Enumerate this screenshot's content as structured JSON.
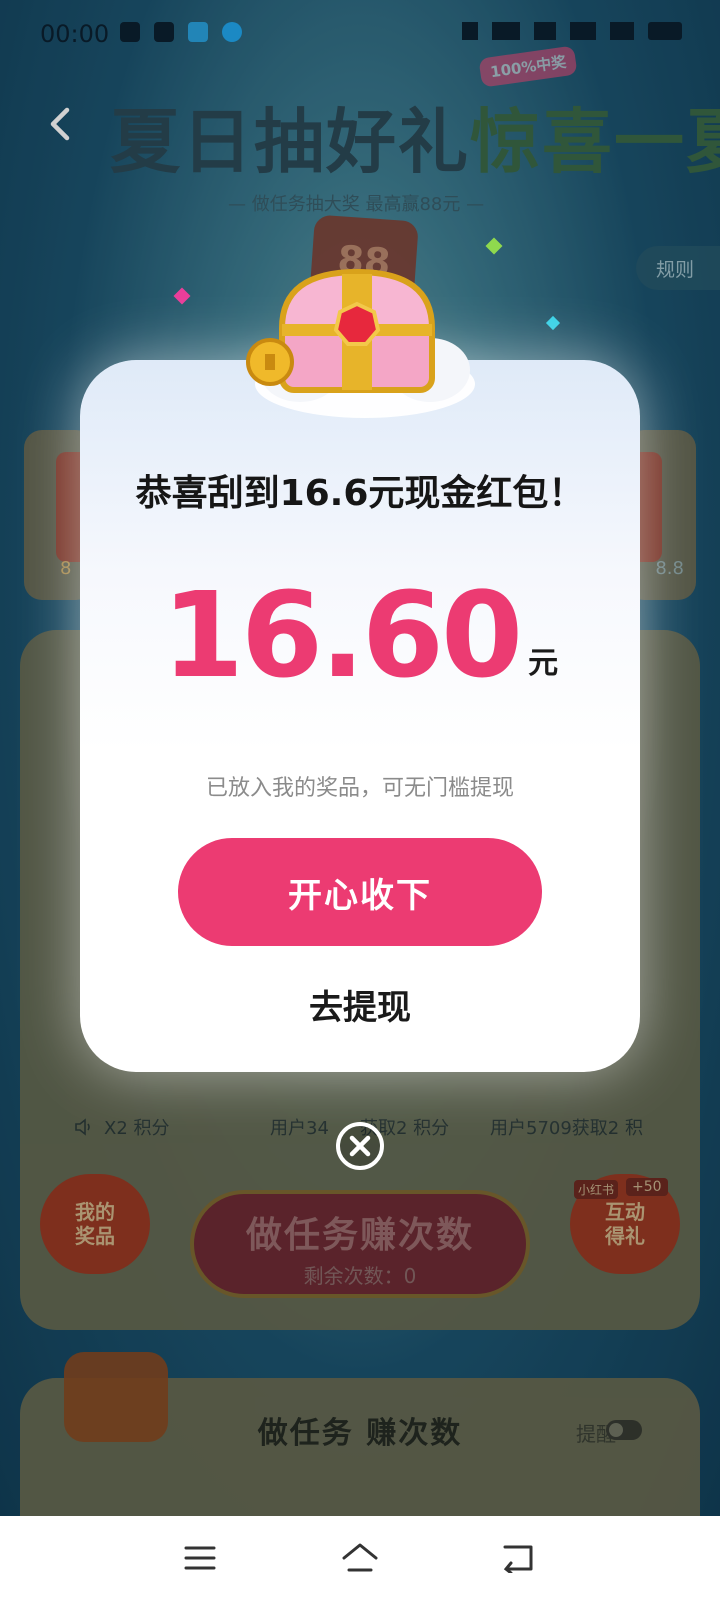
{
  "status_bar": {
    "time": "00:00"
  },
  "background": {
    "hero_title_part1": "夏日抽好礼",
    "hero_title_part2": "惊喜一夏",
    "hero_badge": "100%中奖",
    "hero_subtitle": "— 做任务抽大奖 最高赢88元 —",
    "rule_button": "规则",
    "deco_amount": "88",
    "prize_left_label": "8",
    "prize_right_label": "8.8",
    "ticker": {
      "item1": "X2 积分",
      "item2": "用户34",
      "item2b": "获取2 积分",
      "item3": "用户5709获取2 积"
    },
    "my_prize_line1": "我的",
    "my_prize_line2": "奖品",
    "task_button_title": "做任务赚次数",
    "task_button_sub": "剩余次数：0",
    "interact_line1": "互动",
    "interact_line2": "得礼",
    "interact_tag": "小红书",
    "interact_tag2": "+50",
    "task_section_title": "做任务  赚次数",
    "remind_label": "提醒"
  },
  "modal": {
    "title": "恭喜刮到16.6元现金红包！",
    "amount": "16.60",
    "unit": "元",
    "note": "已放入我的奖品，可无门槛提现",
    "primary_button": "开心收下",
    "secondary_link": "去提现"
  },
  "colors": {
    "accent": "#ec3b72",
    "modal_bg": "#ffffff",
    "text_dark": "#161616",
    "text_muted": "#8b8b8b"
  },
  "icons": {
    "back": "chevron-left-icon",
    "close": "close-circle-icon",
    "chest": "treasure-chest-icon",
    "nav_menu": "menu-icon",
    "nav_home": "home-icon",
    "nav_back": "back-icon"
  }
}
